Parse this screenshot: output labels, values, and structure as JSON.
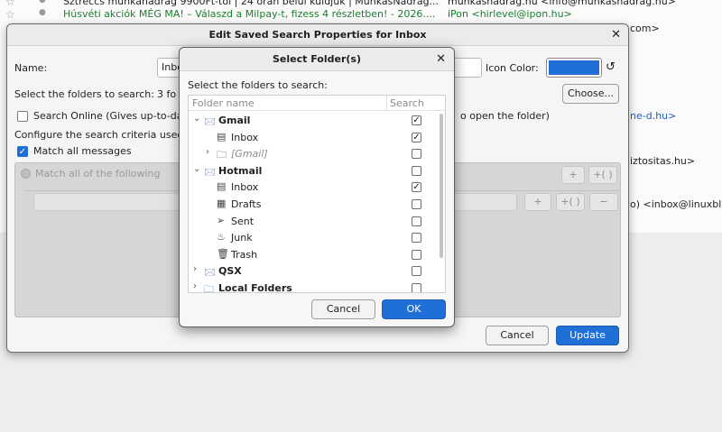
{
  "mail_list": {
    "rows": [
      {
        "subject": "Sztreccs munkanadrag 9900Ft-tol | 24 oran belul kuldjuk | MunkasNadrag...",
        "from": "munkasnadrag.hu <info@munkasnadrag.hu>"
      },
      {
        "subject": "Húsvéti akciók MÉG MA! – Válaszd a Milpay-t, fizess 4 részletben! - 2026....",
        "from": "iPon <hirlevel@ipon.hu>"
      }
    ],
    "side_texts": [
      "com>",
      "ne-d.hu>",
      "iztositas.hu>",
      "o) <inbox@linuxbl..."
    ]
  },
  "edit_dialog": {
    "title": "Edit Saved Search Properties for Inbox",
    "name_label": "Name:",
    "name_value": "Inbox",
    "icon_color_label": "Icon Color:",
    "icon_color": "#1f6fd6",
    "folders_label": "Select the folders to search:",
    "folders_count": "3 fo",
    "choose_button": "Choose...",
    "search_online_label": "Search Online (Gives up-to-da",
    "search_online_tail": "o open the folder)",
    "configure_label": "Configure the search criteria used",
    "match_all_messages_label": "Match all messages",
    "match_all_following_label": "Match all of the following",
    "plus_label": "+",
    "plus_group_label": "+( )",
    "minus_label": "−",
    "cancel_button": "Cancel",
    "update_button": "Update"
  },
  "select_dialog": {
    "title": "Select Folder(s)",
    "prompt": "Select the folders to search:",
    "col_folder": "Folder name",
    "col_search": "Search",
    "folders": [
      {
        "name": "Gmail",
        "level": 0,
        "bold": true,
        "italic": false,
        "twisty": "open",
        "icon": "account-icon",
        "checked": true
      },
      {
        "name": "Inbox",
        "level": 1,
        "bold": false,
        "italic": false,
        "twisty": "",
        "icon": "inbox-icon",
        "checked": true
      },
      {
        "name": "[Gmail]",
        "level": 1,
        "bold": false,
        "italic": true,
        "twisty": "closed",
        "icon": "folder-icon",
        "checked": false
      },
      {
        "name": "Hotmail",
        "level": 0,
        "bold": true,
        "italic": false,
        "twisty": "open",
        "icon": "account-icon",
        "checked": false
      },
      {
        "name": "Inbox",
        "level": 1,
        "bold": false,
        "italic": false,
        "twisty": "",
        "icon": "inbox-icon",
        "checked": true
      },
      {
        "name": "Drafts",
        "level": 1,
        "bold": false,
        "italic": false,
        "twisty": "",
        "icon": "drafts-icon",
        "checked": false
      },
      {
        "name": "Sent",
        "level": 1,
        "bold": false,
        "italic": false,
        "twisty": "",
        "icon": "sent-icon",
        "checked": false
      },
      {
        "name": "Junk",
        "level": 1,
        "bold": false,
        "italic": false,
        "twisty": "",
        "icon": "junk-icon",
        "checked": false
      },
      {
        "name": "Trash",
        "level": 1,
        "bold": false,
        "italic": false,
        "twisty": "",
        "icon": "trash-icon",
        "checked": false
      },
      {
        "name": "QSX",
        "level": 0,
        "bold": true,
        "italic": false,
        "twisty": "closed",
        "icon": "account-icon",
        "checked": false
      },
      {
        "name": "Local Folders",
        "level": 0,
        "bold": true,
        "italic": false,
        "twisty": "closed",
        "icon": "local-folder-icon",
        "checked": false
      }
    ],
    "cancel_button": "Cancel",
    "ok_button": "OK"
  }
}
